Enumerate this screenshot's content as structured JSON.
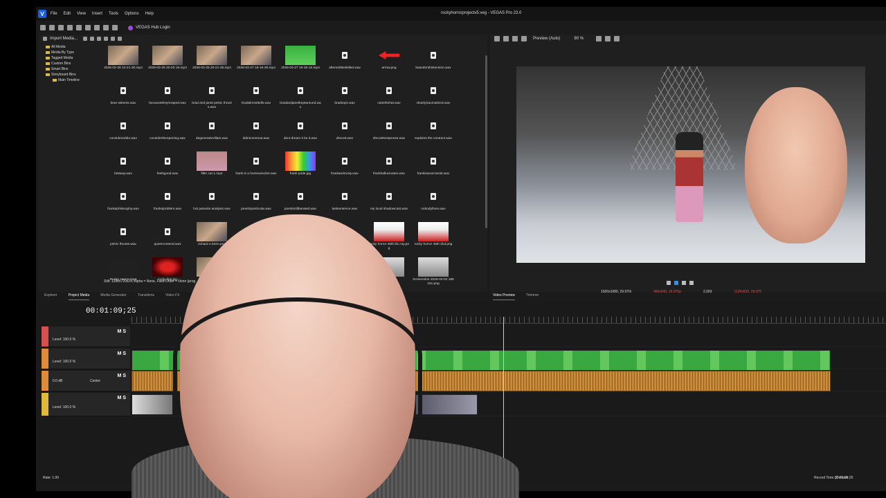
{
  "window": {
    "title": "rockyhorrorprojectv5.veg - VEGAS Pro 23.0",
    "app_icon_letter": "V",
    "menu": [
      "File",
      "Edit",
      "View",
      "Insert",
      "Tools",
      "Options",
      "Help"
    ],
    "hub_label": "VEGAS Hub Login"
  },
  "media": {
    "toolbar_label": "Import Media...",
    "tree": [
      "All Media",
      "Media By Type",
      "Tagged Media",
      "Custom Bins",
      "Smart Bins",
      "Storyboard Bins"
    ],
    "tree_child": "Main Timeline",
    "status": "Still: 1280x720x24, Alpha = None, Field Order = None (prog",
    "rows": [
      [
        {
          "name": "2026-02-28 12-21-30.mp4",
          "kind": "face"
        },
        {
          "name": "2026-03-25 20-20-18.mp4",
          "kind": "face"
        },
        {
          "name": "2026-03-25 20-21-38.mp4",
          "kind": "face"
        },
        {
          "name": "2026-03-27 18-16-29.mp4",
          "kind": "face"
        },
        {
          "name": "2026-03-27 18-35-15.mp4",
          "kind": "green"
        },
        {
          "name": "afteredditeskilled.wav",
          "kind": "audio"
        },
        {
          "name": "arrow.png",
          "kind": "arrow"
        },
        {
          "name": "basedonthistension.wav",
          "kind": "audio"
        }
      ],
      [
        {
          "name": "bear witness.wav",
          "kind": "audio"
        },
        {
          "name": "becausetheyreraped.wav",
          "kind": "audio"
        },
        {
          "name": "brad and janet pelvic thrusts.wav",
          "kind": "audio"
        },
        {
          "name": "bradalmosttells.wav",
          "kind": "audio"
        },
        {
          "name": "bradandjanetkeptaround.wav",
          "kind": "audio"
        },
        {
          "name": "bradsays.wav",
          "kind": "audio"
        },
        {
          "name": "catinthehat.wav",
          "kind": "audio"
        },
        {
          "name": "clearlytraumatized.wav",
          "kind": "audio"
        }
      ],
      [
        {
          "name": "considereddie.wav",
          "kind": "audio"
        },
        {
          "name": "considertheopening.wav",
          "kind": "audio"
        },
        {
          "name": "degeneratevillain.wav",
          "kind": "audio"
        },
        {
          "name": "didntcomeout.wav",
          "kind": "audio"
        },
        {
          "name": "dont dream it be it.wav",
          "kind": "audio"
        },
        {
          "name": "drscott.wav",
          "kind": "audio"
        },
        {
          "name": "drscottsresponse.wav",
          "kind": "audio"
        },
        {
          "name": "explains the contract.wav",
          "kind": "audio"
        }
      ],
      [
        {
          "name": "fastway.wav",
          "kind": "audio"
        },
        {
          "name": "feelsgood.wav",
          "kind": "audio"
        },
        {
          "name": "filler cat 1.mp4",
          "kind": "cat"
        },
        {
          "name": "frank is a homewrecker.wav",
          "kind": "audio"
        },
        {
          "name": "frank pride.jpg",
          "kind": "rainbow"
        },
        {
          "name": "frankandrocky.wav",
          "kind": "audio"
        },
        {
          "name": "frankhallucinates.wav",
          "kind": "audio"
        },
        {
          "name": "frankisanarcissist.wav",
          "kind": "audio"
        }
      ],
      [
        {
          "name": "franksphilosophy.wav",
          "kind": "audio"
        },
        {
          "name": "franksproblem.wav",
          "kind": "audio"
        },
        {
          "name": "hot patootie analysis.wav",
          "kind": "audio"
        },
        {
          "name": "janetinparticular.wav",
          "kind": "audio"
        },
        {
          "name": "janetisntliberated.wav",
          "kind": "audio"
        },
        {
          "name": "lastsentence.wav",
          "kind": "audio"
        },
        {
          "name": "my local shadowcast.wav",
          "kind": "audio"
        },
        {
          "name": "nobodyfixes.wav",
          "kind": "audio"
        }
      ],
      [
        {
          "name": "pelvic thrusts.wav",
          "kind": "audio"
        },
        {
          "name": "queercontend.wav",
          "kind": "audio"
        },
        {
          "name": "richard o brien.png",
          "kind": "face"
        },
        {
          "name": "",
          "kind": "audio"
        },
        {
          "name": "",
          "kind": "hidden"
        },
        {
          "name": "",
          "kind": "hidden"
        },
        {
          "name": "rocky horror 35th blu ray.png",
          "kind": "poster"
        },
        {
          "name": "rocky horror 45th dvd.png",
          "kind": "poster"
        }
      ],
      [
        {
          "name": "Rocky Horror.mp4",
          "kind": "dark"
        },
        {
          "name": "rocky lips.jpg",
          "kind": "lips"
        },
        {
          "name": "rocky",
          "kind": "face"
        },
        {
          "name": "",
          "kind": "hidden"
        },
        {
          "name": "",
          "kind": "hidden"
        },
        {
          "name": "",
          "kind": "hidden"
        },
        {
          "name": "03-02",
          "kind": "screen"
        },
        {
          "name": "Screenshot 2026-03-02 185151.png",
          "kind": "screen"
        }
      ]
    ]
  },
  "preview": {
    "mode_label": "Preview (Auto)",
    "zoom": "90 %",
    "project_info": "1920x1080, 29.970i",
    "preview_info": "960x540, 29.970p",
    "frame": "2,093",
    "display_info": "1120x630, 29.970"
  },
  "tabs_left": [
    "Explorer",
    "Project Media",
    "Media Generator",
    "Transitions",
    "Video FX"
  ],
  "tabs_left_active": "Project Media",
  "tabs_right": [
    "Video Preview",
    "Trimmer"
  ],
  "tabs_right_active": "Video Preview",
  "timeline": {
    "timecode": "00:01:09;25",
    "tracks": [
      {
        "level": "Level: 100.0 %",
        "color": "#d94f4f"
      },
      {
        "level": "Level: 100.0 %",
        "color": "#e08a3a"
      },
      {
        "level": "0.0 dB",
        "pan": "Center",
        "color": "#e08a3a"
      },
      {
        "level": "Level: 100.0 %",
        "color": "#e0b83a"
      }
    ],
    "ms_label": "M S",
    "rate": "Rate: 1.00",
    "end_time": "00:01:09;25"
  },
  "record_time": "Record Time (2 chann"
}
